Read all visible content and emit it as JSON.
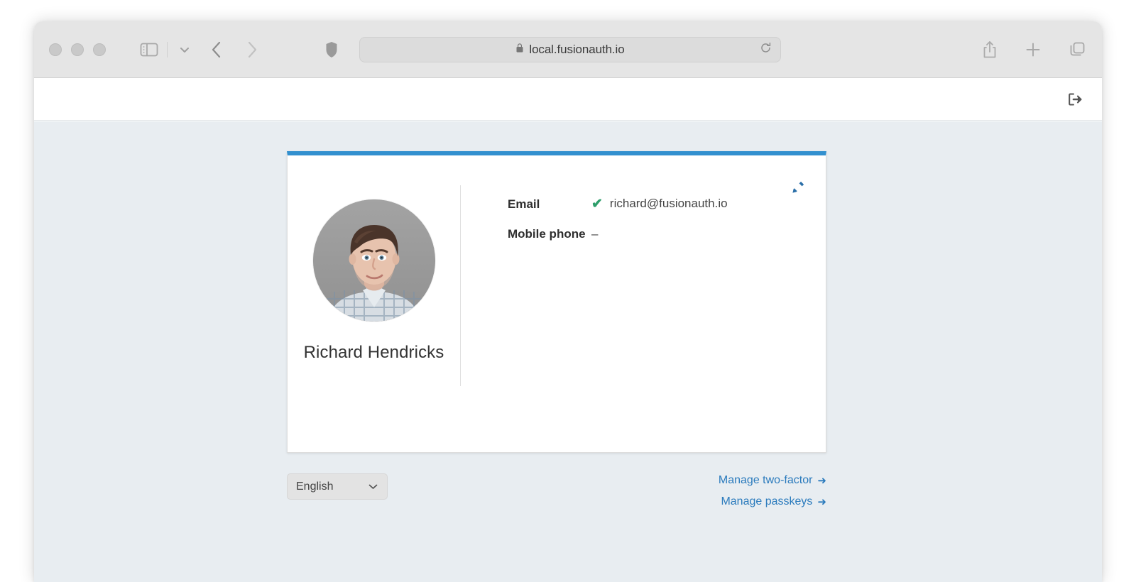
{
  "browser": {
    "url": "local.fusionauth.io",
    "lock_icon": "lock-icon",
    "reload_icon": "reload-icon",
    "shield_icon": "shield-icon",
    "sidebar_icon": "sidebar-toggle-icon",
    "chevron_icon": "chevron-down-icon",
    "back_icon": "back-arrow-icon",
    "forward_icon": "forward-arrow-icon",
    "share_icon": "share-icon",
    "new_tab_icon": "plus-icon",
    "tabs_icon": "tab-overview-icon"
  },
  "header": {
    "logout_icon": "logout-icon"
  },
  "card": {
    "edit_icon": "pencil-edit-icon",
    "avatar_alt": "user-avatar-photo",
    "user_name": "Richard Hendricks",
    "details": [
      {
        "label": "Email",
        "value": "richard@fusionauth.io",
        "verified": true,
        "check": "✔"
      },
      {
        "label": "Mobile phone",
        "value": "–",
        "verified": false
      }
    ]
  },
  "footer": {
    "locale": {
      "selected": "English",
      "options": [
        "English"
      ],
      "chevron_icon": "chevron-down-icon"
    },
    "links": [
      {
        "label": "Manage two-factor",
        "arrow": "➜"
      },
      {
        "label": "Manage passkeys",
        "arrow": "➜"
      }
    ]
  },
  "colors": {
    "accent_blue": "#3290cf",
    "link_blue": "#2b7bbd",
    "verified_green": "#2e9e6b",
    "page_bg": "#e8edf1"
  }
}
